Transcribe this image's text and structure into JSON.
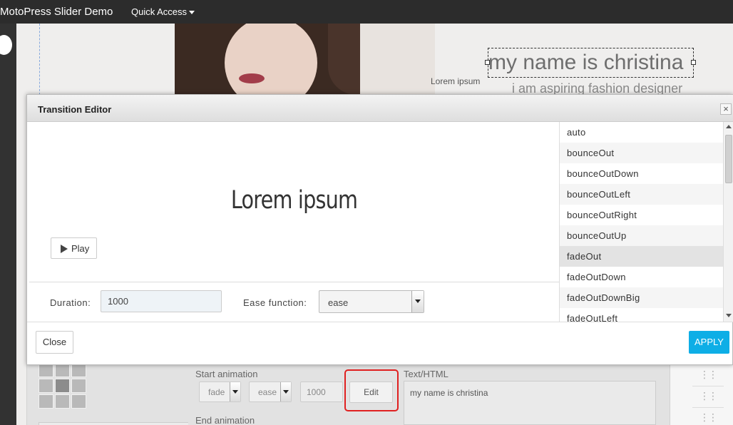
{
  "topbar": {
    "site_title": "MotoPress Slider Demo",
    "quick_access": "Quick Access"
  },
  "slide": {
    "heading": "my name is christina",
    "subheading": "i am aspiring fashion designer",
    "small_text": "Lorem ipsum"
  },
  "modal": {
    "title": "Transition Editor",
    "close_x": "×",
    "preview_text": "Lorem ipsum",
    "play_label": "Play",
    "duration_label": "Duration:",
    "duration_value": "1000",
    "ease_label": "Ease function:",
    "ease_value": "ease",
    "effects": [
      "auto",
      "bounceOut",
      "bounceOutDown",
      "bounceOutLeft",
      "bounceOutRight",
      "bounceOutUp",
      "fadeOut",
      "fadeOutDown",
      "fadeOutDownBig",
      "fadeOutLeft"
    ],
    "selected_effect": "fadeOut",
    "close_button": "Close",
    "apply_button": "APPLY"
  },
  "layer_panel": {
    "start_animation_label": "Start animation",
    "end_animation_label": "End animation",
    "text_html_label": "Text/HTML",
    "start_effect": "fade",
    "start_ease": "ease",
    "start_duration": "1000",
    "edit_button": "Edit",
    "text_html_value": "my name is christina",
    "drag_handle": "⋮⋮"
  }
}
